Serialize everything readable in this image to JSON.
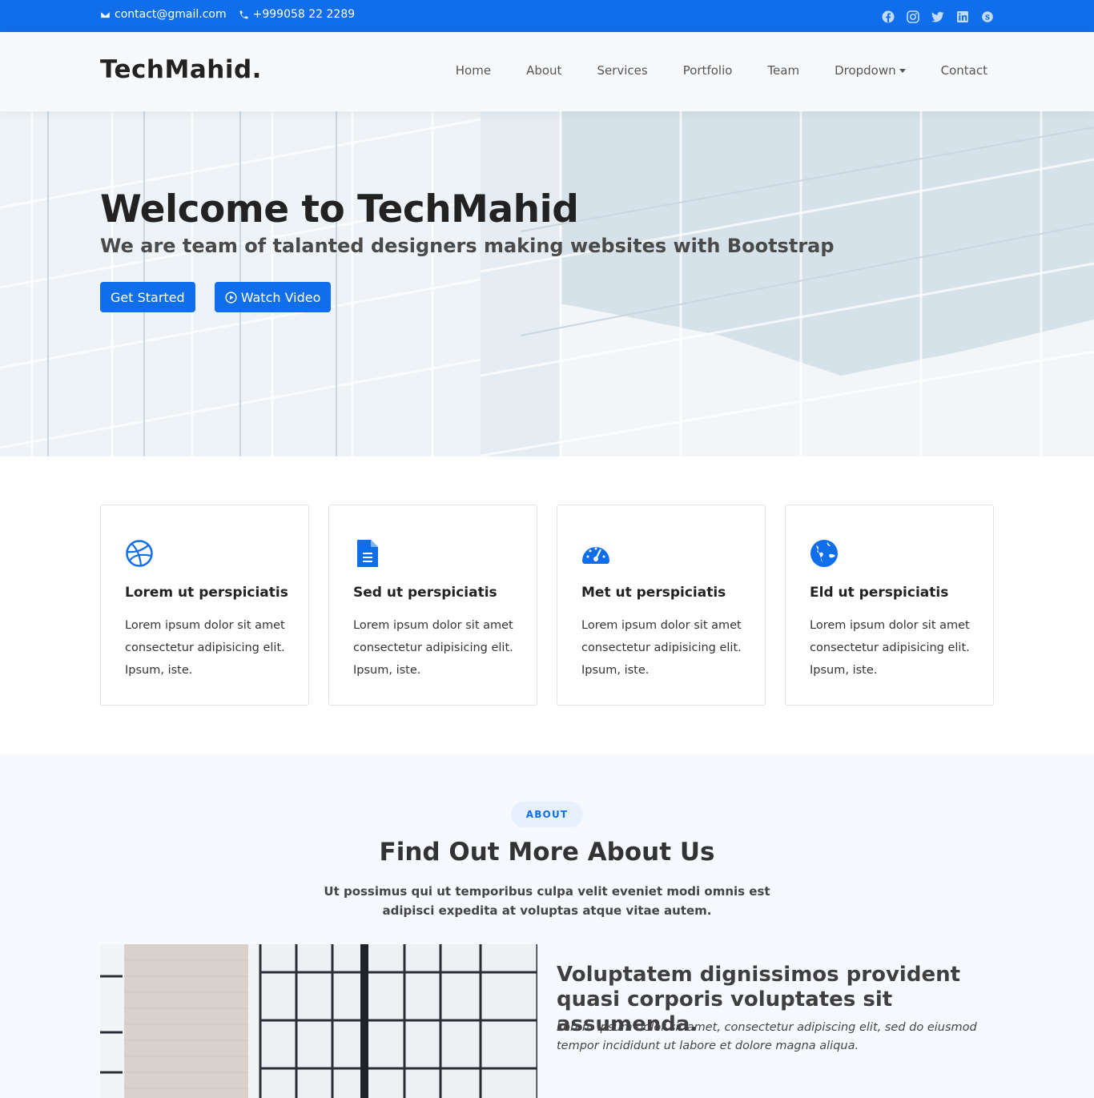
{
  "topbar": {
    "email": "contact@gmail.com",
    "phone": "+999058 22 2289",
    "social_icons": [
      "facebook-icon",
      "instagram-icon",
      "twitter-icon",
      "linkedin-icon",
      "skype-icon"
    ]
  },
  "header": {
    "logo": "TechMahid.",
    "nav": [
      {
        "label": "Home"
      },
      {
        "label": "About"
      },
      {
        "label": "Services"
      },
      {
        "label": "Portfolio"
      },
      {
        "label": "Team"
      },
      {
        "label": "Dropdown"
      },
      {
        "label": "Contact"
      }
    ]
  },
  "hero": {
    "title": "Welcome to TechMahid",
    "subtitle": "We are team of talanted designers making websites with Bootstrap",
    "get_started": "Get Started",
    "watch_video": "Watch Video"
  },
  "featured": [
    {
      "icon": "dribbble-icon",
      "title": "Lorem ut perspiciatis",
      "text": "Lorem ipsum dolor sit amet consectetur adipisicing elit. Ipsum, iste."
    },
    {
      "icon": "document-icon",
      "title": "Sed ut perspiciatis",
      "text": "Lorem ipsum dolor sit amet consectetur adipisicing elit. Ipsum, iste."
    },
    {
      "icon": "speedometer-icon",
      "title": "Met ut perspiciatis",
      "text": "Lorem ipsum dolor sit amet consectetur adipisicing elit. Ipsum, iste."
    },
    {
      "icon": "globe-icon",
      "title": "Eld ut perspiciatis",
      "text": "Lorem ipsum dolor sit amet consectetur adipisicing elit. Ipsum, iste."
    }
  ],
  "about": {
    "badge": "ABOUT",
    "title": "Find Out More About Us",
    "lead": "Ut possimus qui ut temporibus culpa velit eveniet modi omnis est adipisci expedita at voluptas atque vitae autem.",
    "heading": "Voluptatem dignissimos provident quasi corporis voluptates sit assumenda.",
    "italic": "Lorem ipsum dolor sit amet, consectetur adipiscing elit, sed do eiusmod tempor incididunt ut labore et dolore magna aliqua."
  },
  "colors": {
    "accent": "#106eea"
  }
}
